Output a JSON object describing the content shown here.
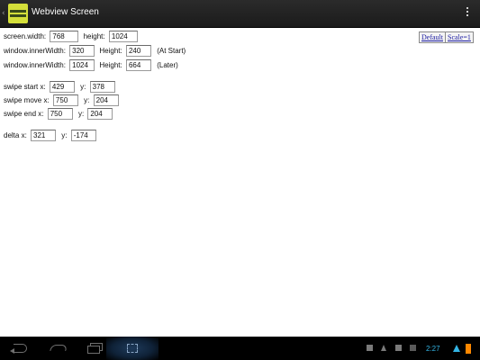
{
  "app": {
    "title": "Webview Screen",
    "back_icon": "chevron-left-icon",
    "menu_icon": "overflow-menu-icon"
  },
  "buttons": {
    "default": "Default",
    "scale": "Scale=1"
  },
  "screen": {
    "width_label": "screen.width:",
    "width_value": "768",
    "height_label": "height:",
    "height_value": "1024"
  },
  "inner_start": {
    "width_label": "window.innerWidth:",
    "width_value": "320",
    "height_label": "Height:",
    "height_value": "240",
    "note": "(At Start)"
  },
  "inner_later": {
    "width_label": "window.innerWidth:",
    "width_value": "1024",
    "height_label": "Height:",
    "height_value": "664",
    "note": "(Later)"
  },
  "swipe_start": {
    "x_label": "swipe start x:",
    "x_value": "429",
    "y_label": "y:",
    "y_value": "378"
  },
  "swipe_move": {
    "x_label": "swipe move x:",
    "x_value": "750",
    "y_label": "y:",
    "y_value": "204"
  },
  "swipe_end": {
    "x_label": "swipe end x:",
    "x_value": "750",
    "y_label": "y:",
    "y_value": "204"
  },
  "delta": {
    "x_label": "delta x:",
    "x_value": "321",
    "y_label": "y:",
    "y_value": "-174"
  },
  "statusbar": {
    "time": "2:27",
    "accent_color": "#33b5e5"
  },
  "navbar": {
    "icons": [
      "back-icon",
      "home-icon",
      "recent-apps-icon",
      "screenshot-icon"
    ]
  }
}
